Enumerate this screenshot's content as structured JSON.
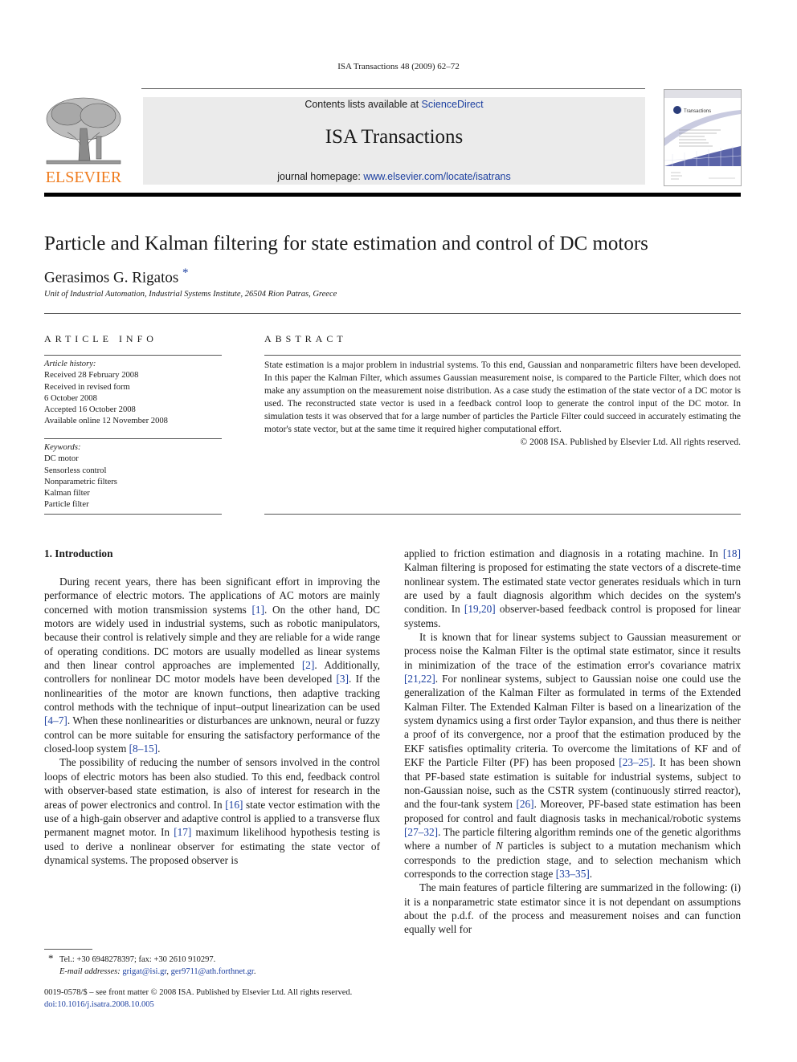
{
  "header": {
    "running_head": "ISA Transactions 48 (2009) 62–72",
    "contents_prefix": "Contents lists available at ",
    "contents_link": "ScienceDirect",
    "journal_title": "ISA Transactions",
    "homepage_prefix": "journal homepage: ",
    "homepage_link": "www.elsevier.com/locate/isatrans",
    "publisher_logo_text": "ELSEVIER",
    "publisher_color": "#ef7b1d",
    "link_color": "#1c3fa0",
    "cover_title": "Transactions"
  },
  "article": {
    "title": "Particle and Kalman filtering for state estimation and control of DC motors",
    "author": "Gerasimos G. Rigatos",
    "author_mark": "*",
    "affiliation": "Unit of Industrial Automation, Industrial Systems Institute, 26504 Rion Patras, Greece"
  },
  "article_info": {
    "heading": "ARTICLE INFO",
    "history_label": "Article history:",
    "history": [
      "Received 28 February 2008",
      "Received in revised form",
      "6 October 2008",
      "Accepted 16 October 2008",
      "Available online 12 November 2008"
    ],
    "keywords_label": "Keywords:",
    "keywords": [
      "DC motor",
      "Sensorless control",
      "Nonparametric filters",
      "Kalman filter",
      "Particle filter"
    ]
  },
  "abstract": {
    "heading": "ABSTRACT",
    "text": "State estimation is a major problem in industrial systems. To this end, Gaussian and nonparametric filters have been developed. In this paper the Kalman Filter, which assumes Gaussian measurement noise, is compared to the Particle Filter, which does not make any assumption on the measurement noise distribution. As a case study the estimation of the state vector of a DC motor is used. The reconstructed state vector is used in a feedback control loop to generate the control input of the DC motor. In simulation tests it was observed that for a large number of particles the Particle Filter could succeed in accurately estimating the motor's state vector, but at the same time it required higher computational effort.",
    "copyright": "© 2008 ISA. Published by Elsevier Ltd. All rights reserved."
  },
  "body": {
    "section_heading": "1.  Introduction",
    "left_paragraphs": [
      [
        {
          "t": "During recent years, there has been significant effort in improving the performance of electric motors. The applications of AC motors are mainly concerned with motion transmission systems "
        },
        {
          "r": "[1]"
        },
        {
          "t": ". On the other hand, DC motors are widely used in industrial systems, such as robotic manipulators, because their control is relatively simple and they are reliable for a wide range of operating conditions. DC motors are usually modelled as linear systems and then linear control approaches are implemented "
        },
        {
          "r": "[2]"
        },
        {
          "t": ". Additionally, controllers for nonlinear DC motor models have been developed "
        },
        {
          "r": "[3]"
        },
        {
          "t": ". If the nonlinearities of the motor are known functions, then adaptive tracking control methods with the technique of input–output linearization can be used "
        },
        {
          "r": "[4–7]"
        },
        {
          "t": ". When these nonlinearities or disturbances are unknown, neural or fuzzy control can be more suitable for ensuring the satisfactory performance of the closed-loop system "
        },
        {
          "r": "[8–15]"
        },
        {
          "t": "."
        }
      ],
      [
        {
          "t": "The possibility of reducing the number of sensors involved in the control loops of electric motors has been also studied. To this end, feedback control with observer-based state estimation, is also of interest for research in the areas of power electronics and control. In "
        },
        {
          "r": "[16]"
        },
        {
          "t": " state vector estimation with the use of a high-gain observer and adaptive control is applied to a transverse flux permanent magnet motor. In "
        },
        {
          "r": "[17]"
        },
        {
          "t": " maximum likelihood hypothesis testing is used to derive a nonlinear observer for estimating the state vector of dynamical systems. The proposed observer is"
        }
      ]
    ],
    "right_paragraphs": [
      [
        {
          "t": "applied to friction estimation and diagnosis in a rotating machine. In "
        },
        {
          "r": "[18]"
        },
        {
          "t": " Kalman filtering is proposed for estimating the state vectors of a discrete-time nonlinear system. The estimated state vector generates residuals which in turn are used by a fault diagnosis algorithm which decides on the system's condition. In "
        },
        {
          "r": "[19,20]"
        },
        {
          "t": " observer-based feedback control is proposed for linear systems."
        }
      ],
      [
        {
          "t": "It is known that for linear systems subject to Gaussian measurement or process noise the Kalman Filter is the optimal state estimator, since it results in minimization of the trace of the estimation error's covariance matrix "
        },
        {
          "r": "[21,22]"
        },
        {
          "t": ". For nonlinear systems, subject to Gaussian noise one could use the generalization of the Kalman Filter as formulated in terms of the Extended Kalman Filter. The Extended Kalman Filter is based on a linearization of the system dynamics using a first order Taylor expansion, and thus there is neither a proof of its convergence, nor a proof that the estimation produced by the EKF satisfies optimality criteria. To overcome the limitations of KF and of EKF the Particle Filter (PF) has been proposed "
        },
        {
          "r": "[23–25]"
        },
        {
          "t": ". It has been shown that PF-based state estimation is suitable for industrial systems, subject to non-Gaussian noise, such as the CSTR system (continuously stirred reactor), and the four-tank system "
        },
        {
          "r": "[26]"
        },
        {
          "t": ". Moreover, PF-based state estimation has been proposed for control and fault diagnosis tasks in mechanical/robotic systems "
        },
        {
          "r": "[27–32]"
        },
        {
          "t": ". The particle filtering algorithm reminds one of the genetic algorithms where a number of "
        },
        {
          "i": "N"
        },
        {
          "t": " particles is subject to a mutation mechanism which corresponds to the prediction stage, and to selection mechanism which corresponds to the correction stage "
        },
        {
          "r": "[33–35]"
        },
        {
          "t": "."
        }
      ],
      [
        {
          "t": "The main features of particle filtering are summarized in the following: (i) it is a nonparametric state estimator since it is not dependant on assumptions about the p.d.f. of the process and measurement noises and can function equally well for"
        }
      ]
    ]
  },
  "footnote": {
    "mark": "*",
    "contact": "Tel.: +30 6948278397; fax: +30 2610 910297.",
    "email_label": "E-mail addresses: ",
    "emails": [
      "grigat@isi.gr",
      "ger9711@ath.forthnet.gr"
    ]
  },
  "front_matter": {
    "issn_line": "0019-0578/$ – see front matter © 2008 ISA. Published by Elsevier Ltd. All rights reserved.",
    "doi": "doi:10.1016/j.isatra.2008.10.005"
  }
}
